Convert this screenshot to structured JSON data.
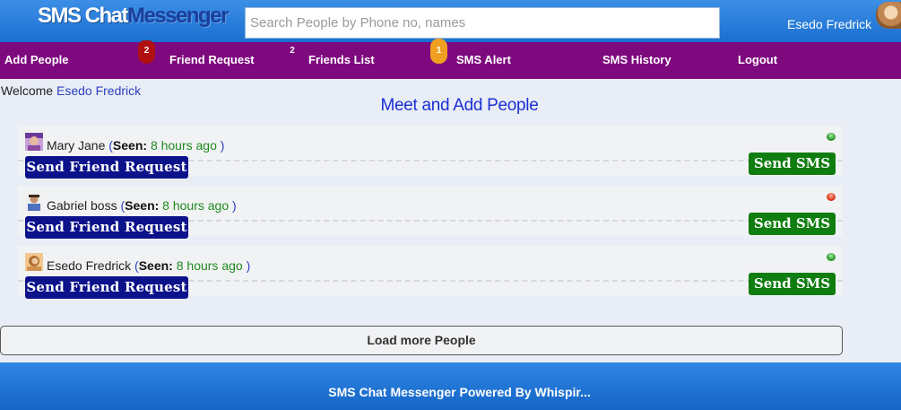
{
  "app": {
    "logo_part1": "SMS Chat",
    "logo_part2": "Messenger"
  },
  "search": {
    "placeholder": "Search People by Phone no, names"
  },
  "user": {
    "name": "Esedo Fredrick"
  },
  "nav": {
    "add_people": "Add People",
    "friend_request": "Friend Request",
    "friend_request_badge": "2",
    "friends_list": "Friends List",
    "friends_list_badge": "2",
    "sms_alert": "SMS Alert",
    "sms_alert_badge": "1",
    "sms_history": "SMS History",
    "logout": "Logout"
  },
  "welcome": {
    "prefix": "Welcome",
    "name": "Esedo Fredrick"
  },
  "page_title": "Meet and Add People",
  "seen_label": "Seen:",
  "buttons": {
    "send_request": "Send Friend Request",
    "send_sms": "Send SMS",
    "load_more": "Load more People"
  },
  "people": [
    {
      "name": "Mary Jane",
      "seen": "8 hours ago",
      "status": "online",
      "status_color": "#2c9a2c"
    },
    {
      "name": "Gabriel boss",
      "seen": "8 hours ago",
      "status": "offline",
      "status_color": "#e03a1a"
    },
    {
      "name": "Esedo Fredrick",
      "seen": "8 hours ago",
      "status": "online",
      "status_color": "#2c9a2c"
    }
  ],
  "footer": {
    "text": "SMS Chat Messenger Powered By Whispir..."
  },
  "colors": {
    "header_blue": "#1a6fd0",
    "nav_purple": "#7e087e",
    "request_button": "#0c128a",
    "sms_button": "#0f7d0f",
    "seen_time": "#1f8a1f"
  }
}
